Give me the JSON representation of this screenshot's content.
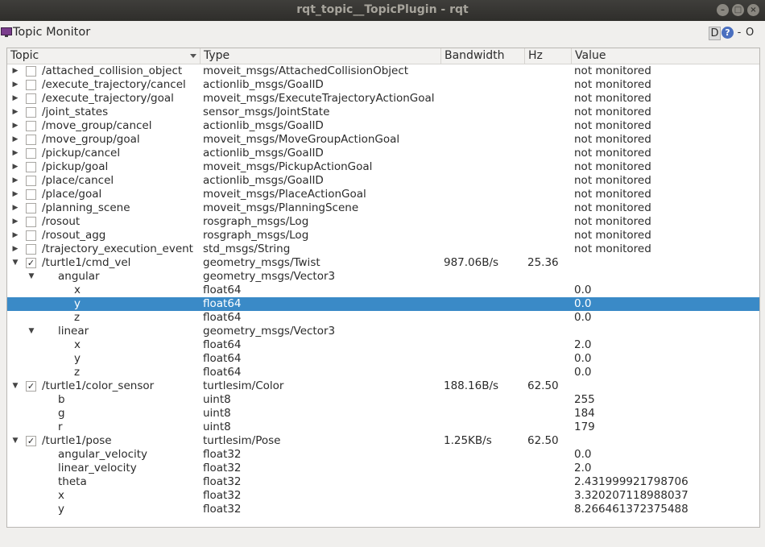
{
  "window": {
    "title": "rqt_topic__TopicPlugin - rqt"
  },
  "plugin": {
    "title": "Topic Monitor",
    "btn_d": "D",
    "btn_help": "?",
    "btn_dash": "-",
    "btn_o": "O"
  },
  "columns": {
    "topic": "Topic",
    "type": "Type",
    "bandwidth": "Bandwidth",
    "hz": "Hz",
    "value": "Value"
  },
  "rows": [
    {
      "depth": 0,
      "exp": "collapsed",
      "check": "off",
      "topic": "/attached_collision_object",
      "type": "moveit_msgs/AttachedCollisionObject",
      "bw": "",
      "hz": "",
      "value": "not monitored"
    },
    {
      "depth": 0,
      "exp": "collapsed",
      "check": "off",
      "topic": "/execute_trajectory/cancel",
      "type": "actionlib_msgs/GoalID",
      "bw": "",
      "hz": "",
      "value": "not monitored"
    },
    {
      "depth": 0,
      "exp": "collapsed",
      "check": "off",
      "topic": "/execute_trajectory/goal",
      "type": "moveit_msgs/ExecuteTrajectoryActionGoal",
      "bw": "",
      "hz": "",
      "value": "not monitored"
    },
    {
      "depth": 0,
      "exp": "collapsed",
      "check": "off",
      "topic": "/joint_states",
      "type": "sensor_msgs/JointState",
      "bw": "",
      "hz": "",
      "value": "not monitored"
    },
    {
      "depth": 0,
      "exp": "collapsed",
      "check": "off",
      "topic": "/move_group/cancel",
      "type": "actionlib_msgs/GoalID",
      "bw": "",
      "hz": "",
      "value": "not monitored"
    },
    {
      "depth": 0,
      "exp": "collapsed",
      "check": "off",
      "topic": "/move_group/goal",
      "type": "moveit_msgs/MoveGroupActionGoal",
      "bw": "",
      "hz": "",
      "value": "not monitored"
    },
    {
      "depth": 0,
      "exp": "collapsed",
      "check": "off",
      "topic": "/pickup/cancel",
      "type": "actionlib_msgs/GoalID",
      "bw": "",
      "hz": "",
      "value": "not monitored"
    },
    {
      "depth": 0,
      "exp": "collapsed",
      "check": "off",
      "topic": "/pickup/goal",
      "type": "moveit_msgs/PickupActionGoal",
      "bw": "",
      "hz": "",
      "value": "not monitored"
    },
    {
      "depth": 0,
      "exp": "collapsed",
      "check": "off",
      "topic": "/place/cancel",
      "type": "actionlib_msgs/GoalID",
      "bw": "",
      "hz": "",
      "value": "not monitored"
    },
    {
      "depth": 0,
      "exp": "collapsed",
      "check": "off",
      "topic": "/place/goal",
      "type": "moveit_msgs/PlaceActionGoal",
      "bw": "",
      "hz": "",
      "value": "not monitored"
    },
    {
      "depth": 0,
      "exp": "collapsed",
      "check": "off",
      "topic": "/planning_scene",
      "type": "moveit_msgs/PlanningScene",
      "bw": "",
      "hz": "",
      "value": "not monitored"
    },
    {
      "depth": 0,
      "exp": "collapsed",
      "check": "off",
      "topic": "/rosout",
      "type": "rosgraph_msgs/Log",
      "bw": "",
      "hz": "",
      "value": "not monitored"
    },
    {
      "depth": 0,
      "exp": "collapsed",
      "check": "off",
      "topic": "/rosout_agg",
      "type": "rosgraph_msgs/Log",
      "bw": "",
      "hz": "",
      "value": "not monitored"
    },
    {
      "depth": 0,
      "exp": "collapsed",
      "check": "off",
      "topic": "/trajectory_execution_event",
      "type": "std_msgs/String",
      "bw": "",
      "hz": "",
      "value": "not monitored"
    },
    {
      "depth": 0,
      "exp": "expanded",
      "check": "on",
      "topic": "/turtle1/cmd_vel",
      "type": "geometry_msgs/Twist",
      "bw": "987.06B/s",
      "hz": "25.36",
      "value": ""
    },
    {
      "depth": 1,
      "exp": "expanded",
      "check": "none",
      "topic": "angular",
      "type": "geometry_msgs/Vector3",
      "bw": "",
      "hz": "",
      "value": ""
    },
    {
      "depth": 2,
      "exp": "none",
      "check": "none",
      "topic": "x",
      "type": "float64",
      "bw": "",
      "hz": "",
      "value": "0.0"
    },
    {
      "depth": 2,
      "exp": "none",
      "check": "none",
      "topic": "y",
      "type": "float64",
      "bw": "",
      "hz": "",
      "value": "0.0",
      "selected": true
    },
    {
      "depth": 2,
      "exp": "none",
      "check": "none",
      "topic": "z",
      "type": "float64",
      "bw": "",
      "hz": "",
      "value": "0.0"
    },
    {
      "depth": 1,
      "exp": "expanded",
      "check": "none",
      "topic": "linear",
      "type": "geometry_msgs/Vector3",
      "bw": "",
      "hz": "",
      "value": ""
    },
    {
      "depth": 2,
      "exp": "none",
      "check": "none",
      "topic": "x",
      "type": "float64",
      "bw": "",
      "hz": "",
      "value": "2.0"
    },
    {
      "depth": 2,
      "exp": "none",
      "check": "none",
      "topic": "y",
      "type": "float64",
      "bw": "",
      "hz": "",
      "value": "0.0"
    },
    {
      "depth": 2,
      "exp": "none",
      "check": "none",
      "topic": "z",
      "type": "float64",
      "bw": "",
      "hz": "",
      "value": "0.0"
    },
    {
      "depth": 0,
      "exp": "expanded",
      "check": "on",
      "topic": "/turtle1/color_sensor",
      "type": "turtlesim/Color",
      "bw": "188.16B/s",
      "hz": "62.50",
      "value": ""
    },
    {
      "depth": 1,
      "exp": "none",
      "check": "none",
      "topic": "b",
      "type": "uint8",
      "bw": "",
      "hz": "",
      "value": "255"
    },
    {
      "depth": 1,
      "exp": "none",
      "check": "none",
      "topic": "g",
      "type": "uint8",
      "bw": "",
      "hz": "",
      "value": "184"
    },
    {
      "depth": 1,
      "exp": "none",
      "check": "none",
      "topic": "r",
      "type": "uint8",
      "bw": "",
      "hz": "",
      "value": "179"
    },
    {
      "depth": 0,
      "exp": "expanded",
      "check": "on",
      "topic": "/turtle1/pose",
      "type": "turtlesim/Pose",
      "bw": "1.25KB/s",
      "hz": "62.50",
      "value": ""
    },
    {
      "depth": 1,
      "exp": "none",
      "check": "none",
      "topic": "angular_velocity",
      "type": "float32",
      "bw": "",
      "hz": "",
      "value": "0.0"
    },
    {
      "depth": 1,
      "exp": "none",
      "check": "none",
      "topic": "linear_velocity",
      "type": "float32",
      "bw": "",
      "hz": "",
      "value": "2.0"
    },
    {
      "depth": 1,
      "exp": "none",
      "check": "none",
      "topic": "theta",
      "type": "float32",
      "bw": "",
      "hz": "",
      "value": "2.431999921798706"
    },
    {
      "depth": 1,
      "exp": "none",
      "check": "none",
      "topic": "x",
      "type": "float32",
      "bw": "",
      "hz": "",
      "value": "3.320207118988037"
    },
    {
      "depth": 1,
      "exp": "none",
      "check": "none",
      "topic": "y",
      "type": "float32",
      "bw": "",
      "hz": "",
      "value": "8.266461372375488"
    }
  ]
}
